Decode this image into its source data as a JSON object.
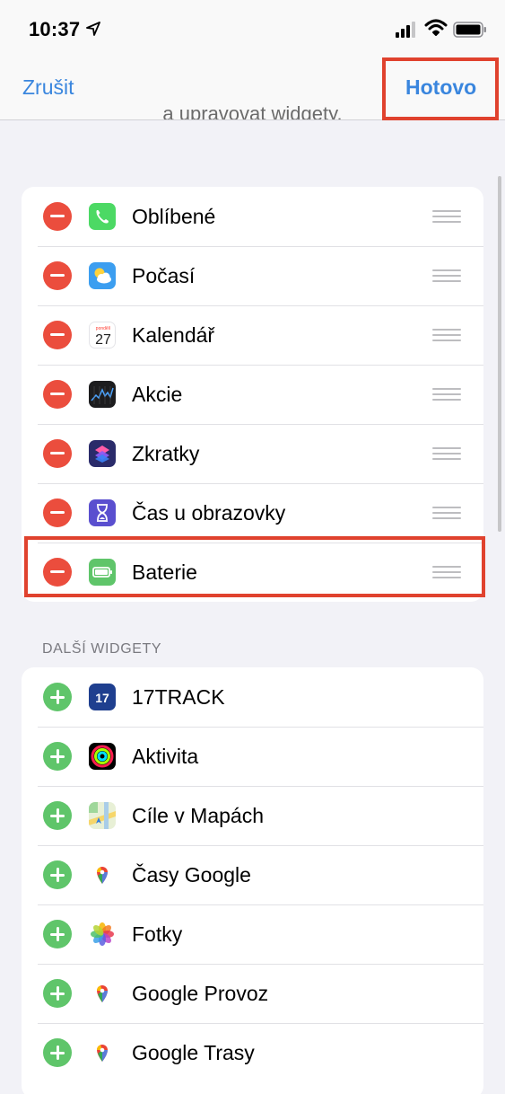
{
  "status_bar": {
    "time": "10:37"
  },
  "nav": {
    "cancel_label": "Zrušit",
    "done_label": "Hotovo",
    "clipped_text": "a upravovat widgety."
  },
  "active_widgets": [
    {
      "label": "Oblíbené",
      "icon": "phone-icon"
    },
    {
      "label": "Počasí",
      "icon": "weather-icon"
    },
    {
      "label": "Kalendář",
      "icon": "calendar-icon",
      "icon_text": "27",
      "icon_day": "pondělí"
    },
    {
      "label": "Akcie",
      "icon": "stocks-icon"
    },
    {
      "label": "Zkratky",
      "icon": "shortcuts-icon"
    },
    {
      "label": "Čas u obrazovky",
      "icon": "hourglass-icon"
    },
    {
      "label": "Baterie",
      "icon": "battery-widget-icon"
    }
  ],
  "more_widgets": {
    "header": "DALŠÍ WIDGETY",
    "items": [
      {
        "label": "17TRACK",
        "icon": "17track-icon",
        "icon_text": "17"
      },
      {
        "label": "Aktivita",
        "icon": "activity-rings-icon"
      },
      {
        "label": "Cíle v Mapách",
        "icon": "maps-icon"
      },
      {
        "label": "Časy Google",
        "icon": "google-maps-icon"
      },
      {
        "label": "Fotky",
        "icon": "photos-icon"
      },
      {
        "label": "Google Provoz",
        "icon": "google-maps-icon"
      },
      {
        "label": "Google Trasy",
        "icon": "google-maps-icon"
      }
    ]
  },
  "colors": {
    "accent": "#3a86de",
    "highlight": "#e0422e",
    "remove": "#eb4d3d",
    "add": "#5fc56a"
  }
}
